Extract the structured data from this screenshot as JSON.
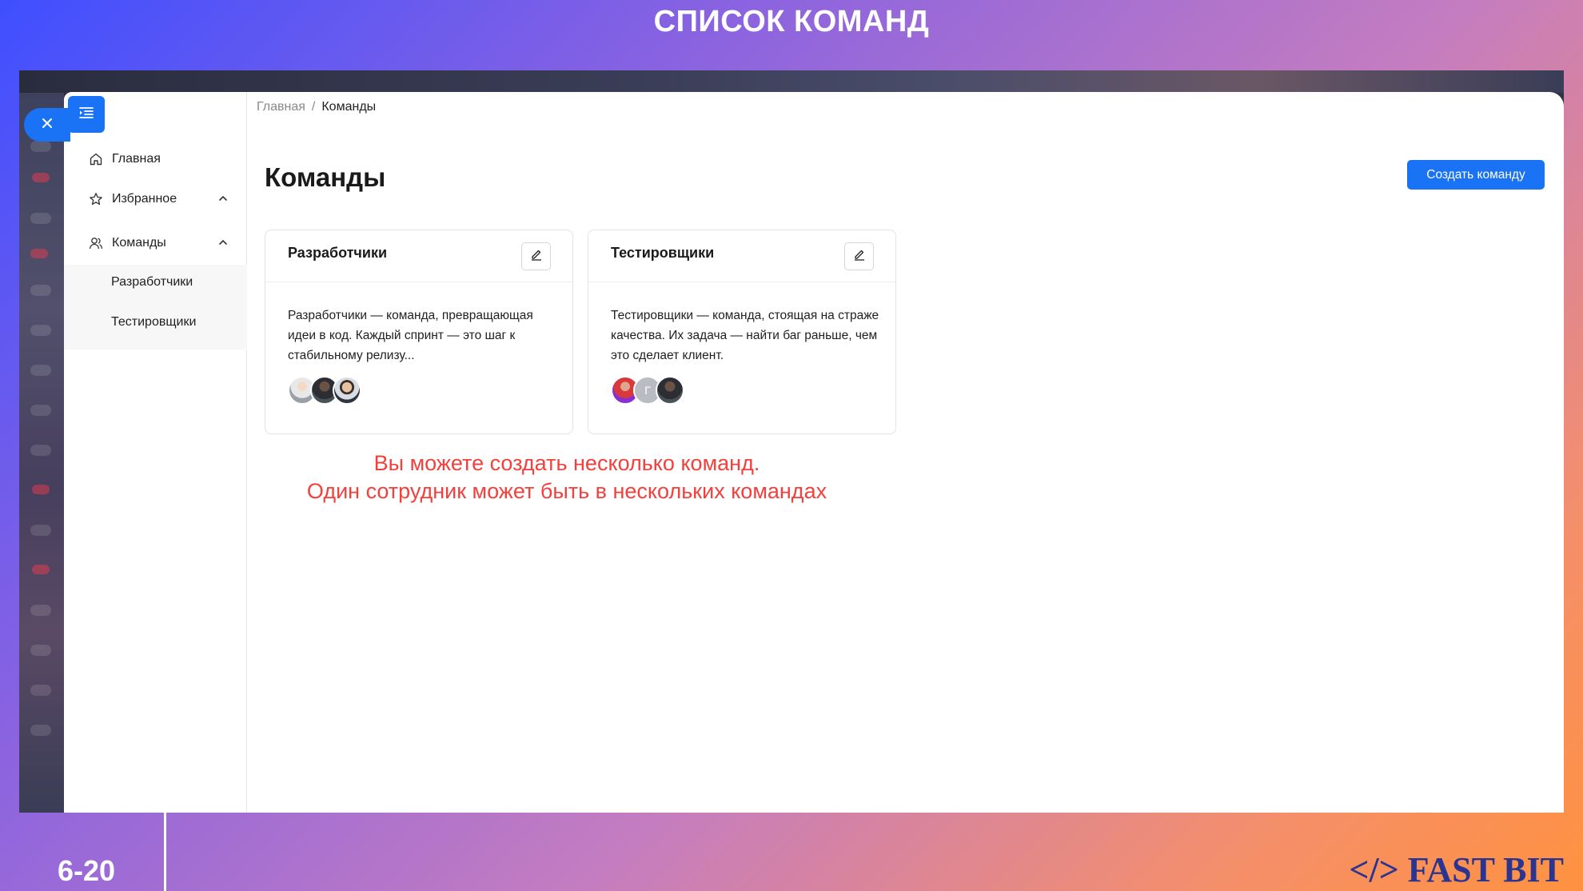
{
  "slide": {
    "title": "СПИСОК КОМАНД",
    "number": "6-20",
    "brand": "</> FAST BIT",
    "accent_color": "#1a73f5",
    "annotation_color": "#f2403c"
  },
  "sidebar": {
    "toggle_icon": "menu-collapse-icon",
    "close_icon": "close-icon",
    "items": [
      {
        "label": "Главная",
        "icon": "home-icon"
      },
      {
        "label": "Избранное",
        "icon": "star-icon",
        "expanded": true
      },
      {
        "label": "Команды",
        "icon": "team-icon",
        "expanded": true
      }
    ],
    "sub_items": [
      {
        "label": "Разработчики"
      },
      {
        "label": "Тестировщики"
      }
    ]
  },
  "breadcrumb": {
    "items": [
      "Главная",
      "Команды"
    ],
    "separator": "/"
  },
  "page": {
    "title": "Команды",
    "create_button": "Создать команду"
  },
  "teams": [
    {
      "name": "Разработчики",
      "description": "Разработчики — команда, превращающая идеи в код. Каждый спринт — это шаг к стабильному релизу...",
      "members": [
        {
          "type": "photo"
        },
        {
          "type": "photo"
        },
        {
          "type": "photo"
        }
      ]
    },
    {
      "name": "Тестировщики",
      "description": "Тестировщики — команда, стоящая на страже качества. Их задача — найти баг раньше, чем это сделает клиент.",
      "members": [
        {
          "type": "photo"
        },
        {
          "type": "initial",
          "initial": "Г"
        },
        {
          "type": "photo"
        }
      ]
    }
  ],
  "annotation": {
    "line1": "Вы можете создать несколько команд.",
    "line2": "Один сотрудник может быть в нескольких командах"
  }
}
